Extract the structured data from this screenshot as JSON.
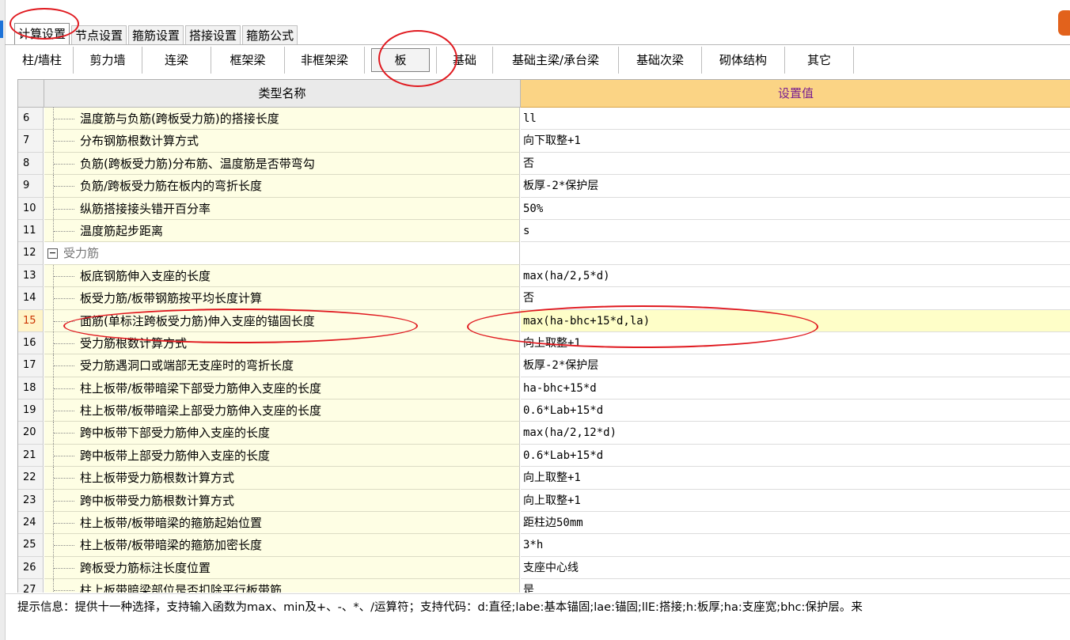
{
  "top_tabs": [
    "计算设置",
    "节点设置",
    "箍筋设置",
    "搭接设置",
    "箍筋公式"
  ],
  "active_top_tab": "计算设置",
  "sub_tabs": [
    "柱/墙柱",
    "剪力墙",
    "连梁",
    "框架梁",
    "非框架梁",
    "板",
    "基础",
    "基础主梁/承台梁",
    "基础次梁",
    "砌体结构",
    "其它"
  ],
  "active_sub_tab": "板",
  "grid": {
    "header_name": "类型名称",
    "header_value": "设置值",
    "rows": [
      {
        "num": "6",
        "name": "温度筋与负筋(跨板受力筋)的搭接长度",
        "value": "ll"
      },
      {
        "num": "7",
        "name": "分布钢筋根数计算方式",
        "value": "向下取整+1"
      },
      {
        "num": "8",
        "name": "负筋(跨板受力筋)分布筋、温度筋是否带弯勾",
        "value": "否"
      },
      {
        "num": "9",
        "name": "负筋/跨板受力筋在板内的弯折长度",
        "value": "板厚-2*保护层"
      },
      {
        "num": "10",
        "name": "纵筋搭接接头错开百分率",
        "value": "50%"
      },
      {
        "num": "11",
        "name": "温度筋起步距离",
        "value": "s"
      },
      {
        "num": "12",
        "name": "受力筋",
        "value": "",
        "group": true
      },
      {
        "num": "13",
        "name": "板底钢筋伸入支座的长度",
        "value": "max(ha/2,5*d)"
      },
      {
        "num": "14",
        "name": "板受力筋/板带钢筋按平均长度计算",
        "value": "否"
      },
      {
        "num": "15",
        "name": "面筋(单标注跨板受力筋)伸入支座的锚固长度",
        "value": "max(ha-bhc+15*d,la)",
        "selected": true
      },
      {
        "num": "16",
        "name": "受力筋根数计算方式",
        "value": "向上取整+1"
      },
      {
        "num": "17",
        "name": "受力筋遇洞口或端部无支座时的弯折长度",
        "value": "板厚-2*保护层"
      },
      {
        "num": "18",
        "name": "柱上板带/板带暗梁下部受力筋伸入支座的长度",
        "value": "ha-bhc+15*d"
      },
      {
        "num": "19",
        "name": "柱上板带/板带暗梁上部受力筋伸入支座的长度",
        "value": "0.6*Lab+15*d"
      },
      {
        "num": "20",
        "name": "跨中板带下部受力筋伸入支座的长度",
        "value": "max(ha/2,12*d)"
      },
      {
        "num": "21",
        "name": "跨中板带上部受力筋伸入支座的长度",
        "value": "0.6*Lab+15*d"
      },
      {
        "num": "22",
        "name": "柱上板带受力筋根数计算方式",
        "value": "向上取整+1"
      },
      {
        "num": "23",
        "name": "跨中板带受力筋根数计算方式",
        "value": "向上取整+1"
      },
      {
        "num": "24",
        "name": "柱上板带/板带暗梁的箍筋起始位置",
        "value": "距柱边50mm"
      },
      {
        "num": "25",
        "name": "柱上板带/板带暗梁的箍筋加密长度",
        "value": "3*h"
      },
      {
        "num": "26",
        "name": "跨板受力筋标注长度位置",
        "value": "支座中心线"
      },
      {
        "num": "27",
        "name": "柱上板带暗梁部位是否扣除平行板带筋",
        "value": "是"
      }
    ]
  },
  "hint_text": "提示信息：提供十一种选择，支持输入函数为max、min及+、-、*、/运算符；支持代码：d:直径;labe:基本锚固;lae:锚固;llE:搭接;h:板厚;ha:支座宽;bhc:保护层。来",
  "annotation_color": "#e0191f"
}
